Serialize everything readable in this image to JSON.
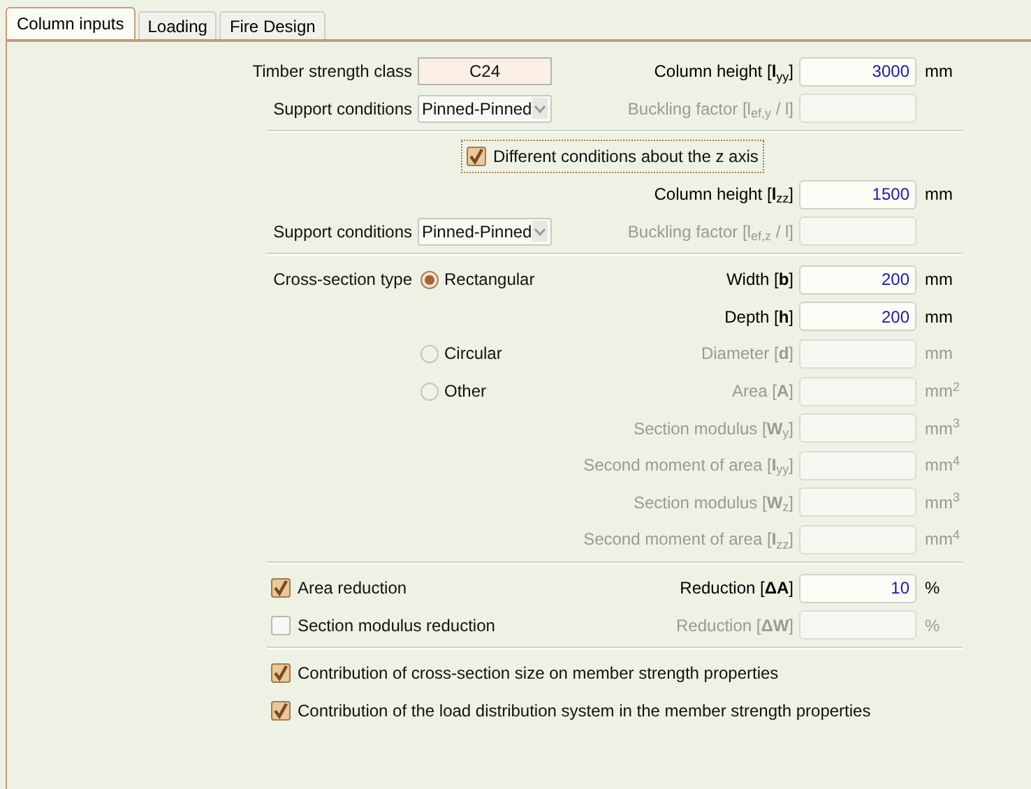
{
  "tabs": [
    {
      "label": "Column inputs",
      "selected": true
    },
    {
      "label": "Loading",
      "selected": false
    },
    {
      "label": "Fire Design",
      "selected": false
    }
  ],
  "rows": [
    {
      "kind": "fields",
      "left": {
        "kind": "text-field",
        "label": "Timber strength class",
        "value": "C24"
      },
      "right": {
        "label": "Column height [**l**$_{yy}$]",
        "value": "3000",
        "unit": "mm",
        "disabled": false
      }
    },
    {
      "kind": "fields",
      "left": {
        "kind": "select",
        "label": "Support conditions",
        "value": "Pinned-Pinned"
      },
      "right": {
        "label": "Buckling factor [l$_{ef,y}$ / l]",
        "disabled": true
      }
    },
    {
      "kind": "divider"
    },
    {
      "kind": "fields",
      "left": {
        "kind": "centered-checkbox",
        "text": "Different conditions about the z axis",
        "checked": true,
        "focused": true
      }
    },
    {
      "kind": "fields",
      "right": {
        "label": "Column height [**l**$_{zz}$]",
        "value": "1500",
        "unit": "mm",
        "disabled": false
      }
    },
    {
      "kind": "fields",
      "left": {
        "kind": "select",
        "label": "Support conditions",
        "value": "Pinned-Pinned"
      },
      "right": {
        "label": "Buckling factor [l$_{ef,z}$ / l]",
        "disabled": true
      }
    },
    {
      "kind": "divider"
    },
    {
      "kind": "fields",
      "left": {
        "kind": "radio",
        "label": "Cross-section type",
        "text": "Rectangular",
        "selected": true
      },
      "right": {
        "label": "Width [**b**]",
        "value": "200",
        "unit": "mm",
        "disabled": false
      }
    },
    {
      "kind": "fields",
      "right": {
        "label": "Depth [**h**]",
        "value": "200",
        "unit": "mm",
        "disabled": false
      }
    },
    {
      "kind": "fields",
      "left": {
        "kind": "radio",
        "text": "Circular",
        "selected": false
      },
      "right": {
        "label": "Diameter [**d**]",
        "unit": "mm",
        "disabled": true
      }
    },
    {
      "kind": "fields",
      "left": {
        "kind": "radio",
        "text": "Other",
        "selected": false
      },
      "right": {
        "label": "Area [**A**]",
        "unit": "mm$^{2}$",
        "disabled": true
      }
    },
    {
      "kind": "fields",
      "right": {
        "label": "Section modulus [**W**$_{y}$]",
        "unit": "mm$^{3}$",
        "disabled": true
      }
    },
    {
      "kind": "fields",
      "right": {
        "label": "Second moment of area [**I**$_{yy}$]",
        "unit": "mm$^{4}$",
        "disabled": true
      }
    },
    {
      "kind": "fields",
      "right": {
        "label": "Section modulus [**W**$_{z}$]",
        "unit": "mm$^{3}$",
        "disabled": true
      }
    },
    {
      "kind": "fields",
      "right": {
        "label": "Second moment of area [**I**$_{zz}$]",
        "unit": "mm$^{4}$",
        "disabled": true
      }
    },
    {
      "kind": "divider"
    },
    {
      "kind": "fields",
      "left": {
        "kind": "checkbox",
        "text": "Area reduction",
        "checked": true,
        "focused": false
      },
      "right": {
        "label": "Reduction [**ΔA**]",
        "value": "10",
        "unit": "%",
        "disabled": false
      }
    },
    {
      "kind": "fields",
      "left": {
        "kind": "checkbox",
        "text": "Section modulus reduction",
        "checked": false,
        "focused": false
      },
      "right": {
        "label": "Reduction [**ΔW**]",
        "unit": "%",
        "disabled": true
      }
    },
    {
      "kind": "divider"
    },
    {
      "kind": "fields",
      "left": {
        "kind": "checkbox",
        "text": "Contribution of cross-section size on member strength properties",
        "checked": true,
        "focused": false
      }
    },
    {
      "kind": "fields",
      "left": {
        "kind": "checkbox",
        "text": "Contribution of the load distribution system in the member strength properties",
        "checked": true,
        "focused": false
      }
    }
  ]
}
